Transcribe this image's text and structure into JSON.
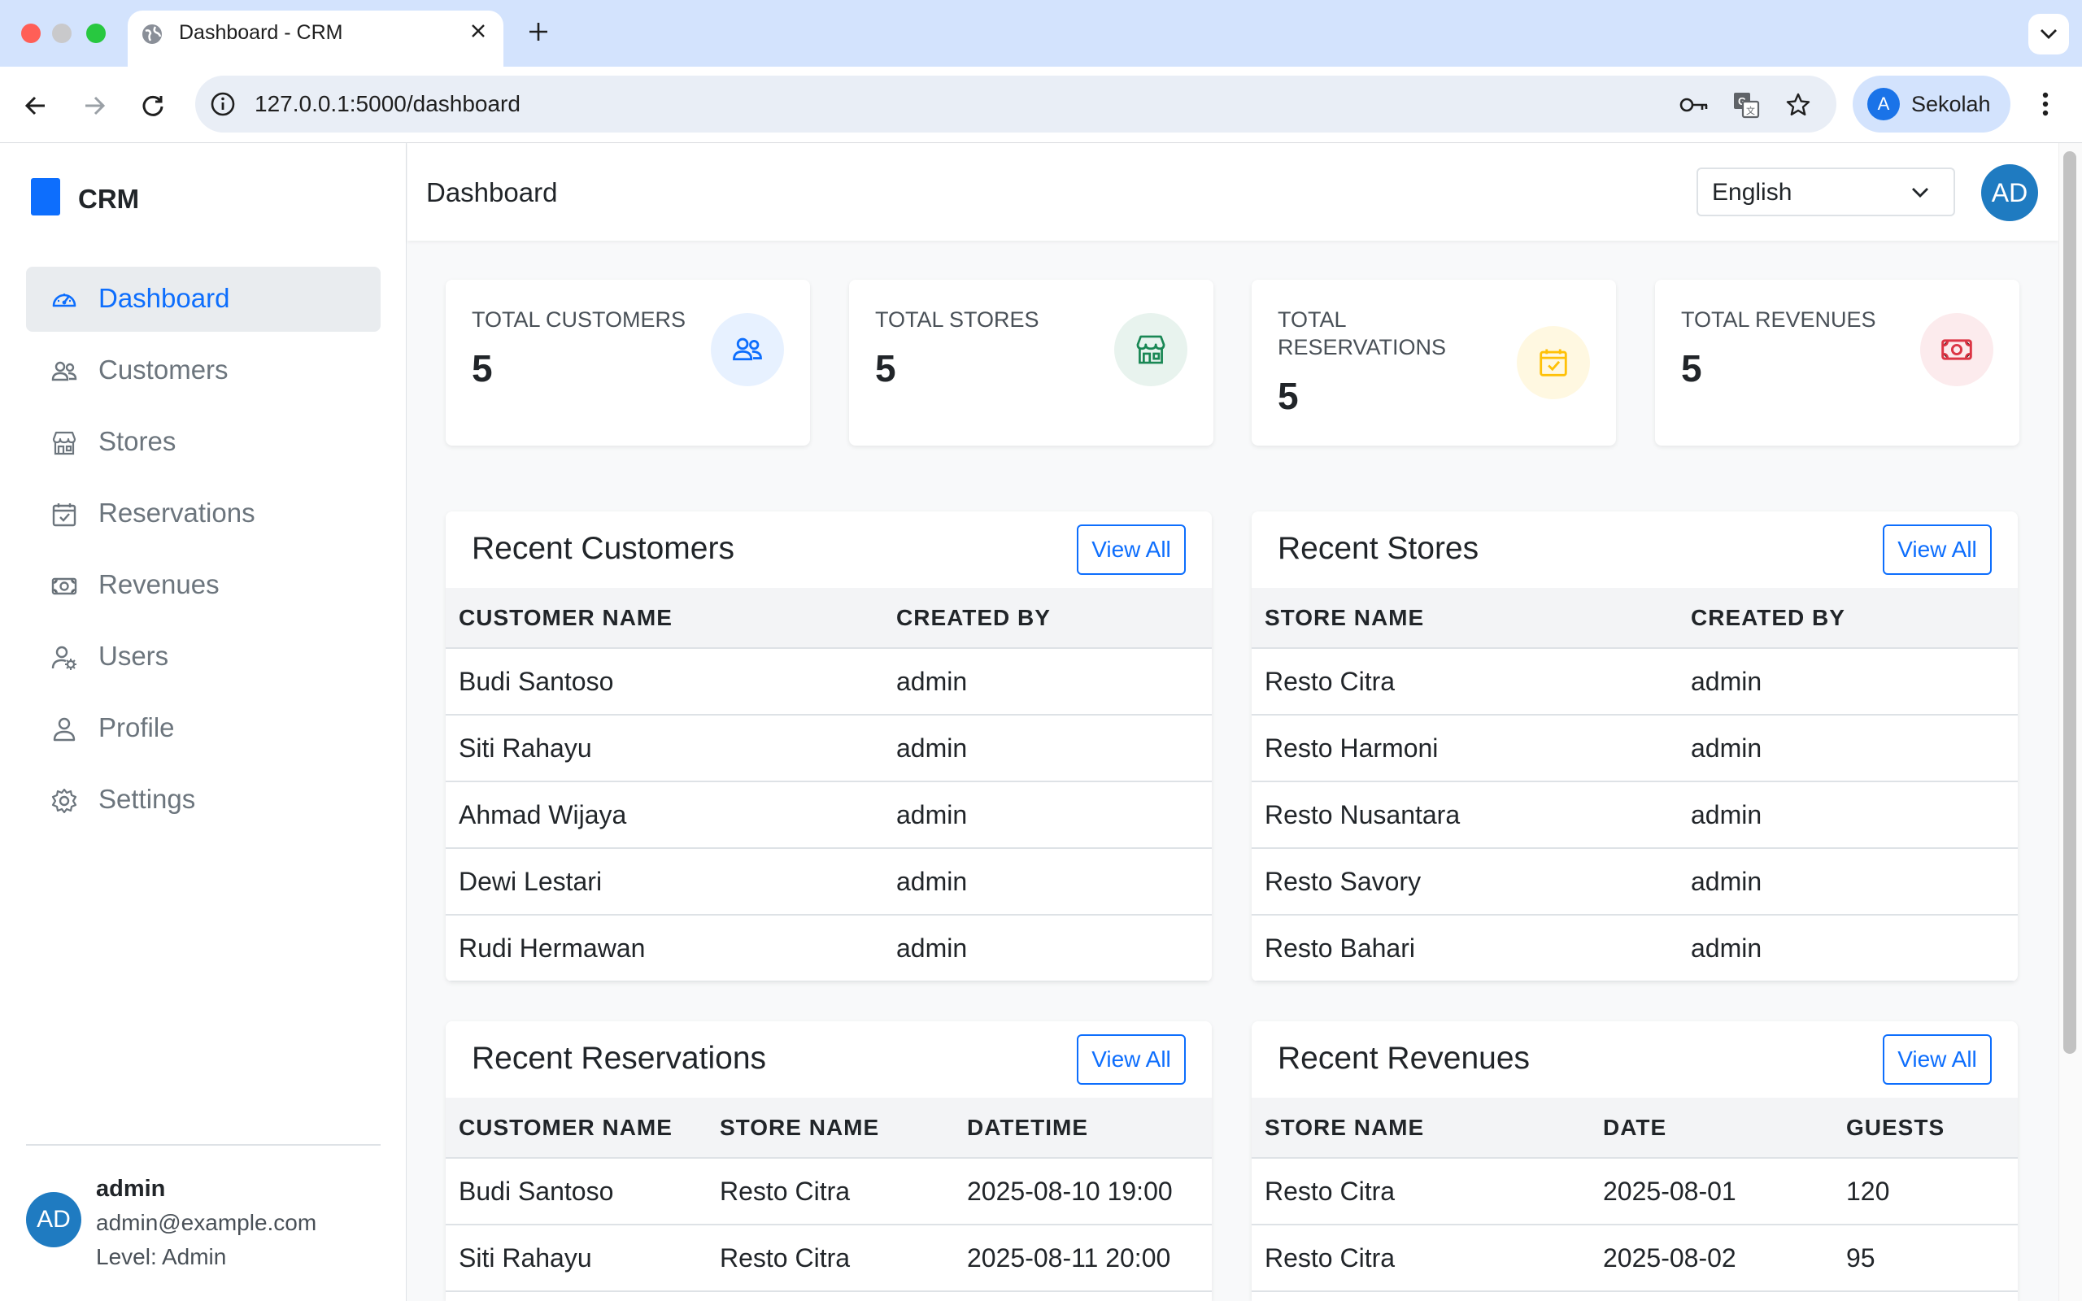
{
  "browser": {
    "tab_title": "Dashboard - CRM",
    "url": "127.0.0.1:5000/dashboard",
    "profile_initial": "A",
    "profile_name": "Sekolah"
  },
  "sidebar": {
    "brand": "CRM",
    "items": [
      {
        "label": "Dashboard",
        "icon": "speedometer-icon",
        "active": true
      },
      {
        "label": "Customers",
        "icon": "people-icon",
        "active": false
      },
      {
        "label": "Stores",
        "icon": "shop-icon",
        "active": false
      },
      {
        "label": "Reservations",
        "icon": "calendar-check-icon",
        "active": false
      },
      {
        "label": "Revenues",
        "icon": "cash-icon",
        "active": false
      },
      {
        "label": "Users",
        "icon": "person-gear-icon",
        "active": false
      },
      {
        "label": "Profile",
        "icon": "person-icon",
        "active": false
      },
      {
        "label": "Settings",
        "icon": "gear-icon",
        "active": false
      }
    ],
    "user": {
      "initials": "AD",
      "name": "admin",
      "email": "admin@example.com",
      "level": "Level: Admin"
    }
  },
  "header": {
    "title": "Dashboard",
    "language": "English",
    "avatar_initials": "AD"
  },
  "stats": [
    {
      "label": "Total Customers",
      "value": "5",
      "icon": "people-icon",
      "color": "#0d6efd",
      "bg": "#e7f1ff"
    },
    {
      "label": "Total Stores",
      "value": "5",
      "icon": "shop-icon",
      "color": "#198754",
      "bg": "#e8f3ee"
    },
    {
      "label": "Total Reservations",
      "value": "5",
      "icon": "calendar-check-icon",
      "color": "#ffc107",
      "bg": "#fff8e1"
    },
    {
      "label": "Total Revenues",
      "value": "5",
      "icon": "cash-icon",
      "color": "#dc3545",
      "bg": "#fcebed"
    }
  ],
  "panels": {
    "recent_customers": {
      "title": "Recent Customers",
      "view_all": "View All",
      "columns": [
        "Customer Name",
        "Created By"
      ],
      "rows": [
        [
          "Budi Santoso",
          "admin"
        ],
        [
          "Siti Rahayu",
          "admin"
        ],
        [
          "Ahmad Wijaya",
          "admin"
        ],
        [
          "Dewi Lestari",
          "admin"
        ],
        [
          "Rudi Hermawan",
          "admin"
        ]
      ]
    },
    "recent_stores": {
      "title": "Recent Stores",
      "view_all": "View All",
      "columns": [
        "Store Name",
        "Created By"
      ],
      "rows": [
        [
          "Resto Citra",
          "admin"
        ],
        [
          "Resto Harmoni",
          "admin"
        ],
        [
          "Resto Nusantara",
          "admin"
        ],
        [
          "Resto Savory",
          "admin"
        ],
        [
          "Resto Bahari",
          "admin"
        ]
      ]
    },
    "recent_reservations": {
      "title": "Recent Reservations",
      "view_all": "View All",
      "columns": [
        "Customer Name",
        "Store Name",
        "Datetime"
      ],
      "rows": [
        [
          "Budi Santoso",
          "Resto Citra",
          "2025-08-10 19:00"
        ],
        [
          "Siti Rahayu",
          "Resto Citra",
          "2025-08-11 20:00"
        ]
      ]
    },
    "recent_revenues": {
      "title": "Recent Revenues",
      "view_all": "View All",
      "columns": [
        "Store Name",
        "Date",
        "Guests"
      ],
      "rows": [
        [
          "Resto Citra",
          "2025-08-01",
          "120"
        ],
        [
          "Resto Citra",
          "2025-08-02",
          "95"
        ]
      ]
    }
  }
}
